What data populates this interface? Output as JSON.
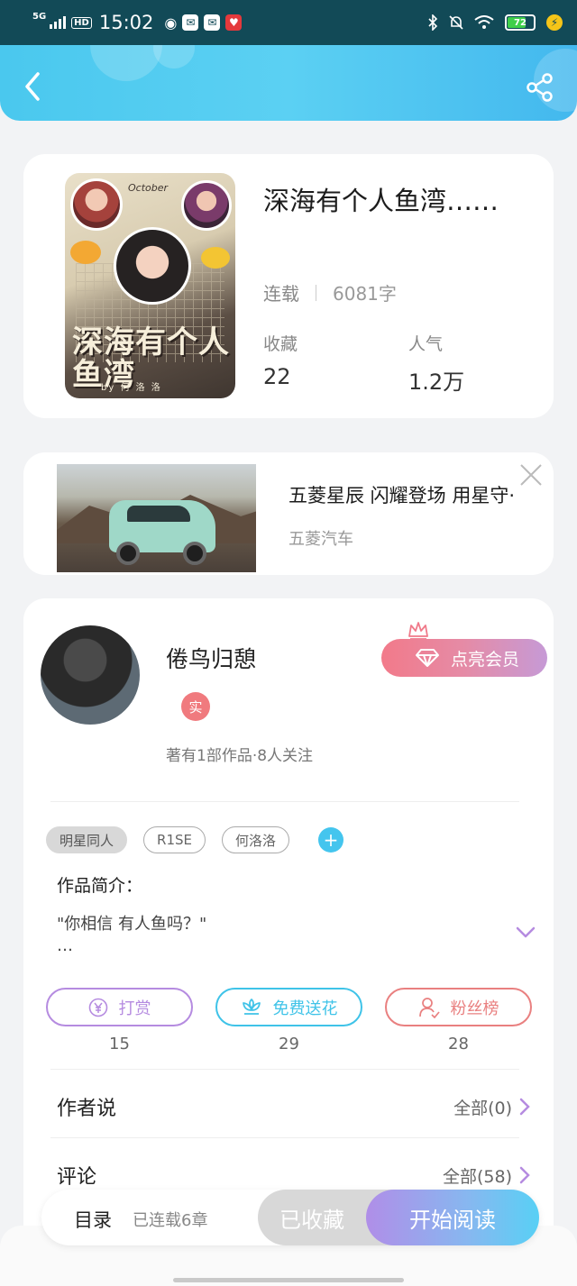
{
  "status_bar": {
    "network": "5G",
    "hd": "HD",
    "time": "15:02",
    "battery": "72",
    "battery_fraction": 0.72
  },
  "colors": {
    "header_gradient": [
      "#4ac8ee",
      "#43b8ee"
    ],
    "accent_blue": "#44c5ee",
    "reward_purple": "#b58be0",
    "flower_cyan": "#3fc3e8",
    "fans_red": "#e98080",
    "read_gradient": [
      "#b08ee8",
      "#58d0f5"
    ]
  },
  "header": {
    "back_icon": "back-chevron-icon",
    "share_icon": "share-icon"
  },
  "book": {
    "title": "深海有个人鱼湾……",
    "status": "连载",
    "word_count": "6081字",
    "fav_label": "收藏",
    "fav_value": "22",
    "pop_label": "人气",
    "pop_value": "1.2万",
    "cover": {
      "top_text": "October",
      "title_text": "深海有个人鱼湾",
      "bottom_text": "by 何 洛 洛"
    }
  },
  "ad": {
    "title": "五菱星辰 闪耀登场 用星守·",
    "brand": "五菱汽车",
    "close_icon": "close-icon"
  },
  "author": {
    "name": "倦鸟归憩",
    "badge": "实",
    "vip_label": "点亮会员",
    "stats": "著有1部作品·8人关注"
  },
  "tags": [
    "明星同人",
    "R1SE",
    "何洛洛"
  ],
  "tag_add": "+",
  "intro": {
    "label": "作品简介：",
    "line1": "\"你相信  有人鱼吗？\"",
    "line2": "…"
  },
  "actions": [
    {
      "label": "打赏",
      "count": "15",
      "icon": "yen-icon"
    },
    {
      "label": "免费送花",
      "count": "29",
      "icon": "flower-icon"
    },
    {
      "label": "粉丝榜",
      "count": "28",
      "icon": "fans-icon"
    }
  ],
  "author_says": {
    "label": "作者说",
    "more": "全部(0)"
  },
  "comments": {
    "label": "评论",
    "more": "全部(58)"
  },
  "bottom_bar": {
    "toc": "目录",
    "chapters": "已连载6章",
    "favorited": "已收藏",
    "read": "开始阅读"
  }
}
